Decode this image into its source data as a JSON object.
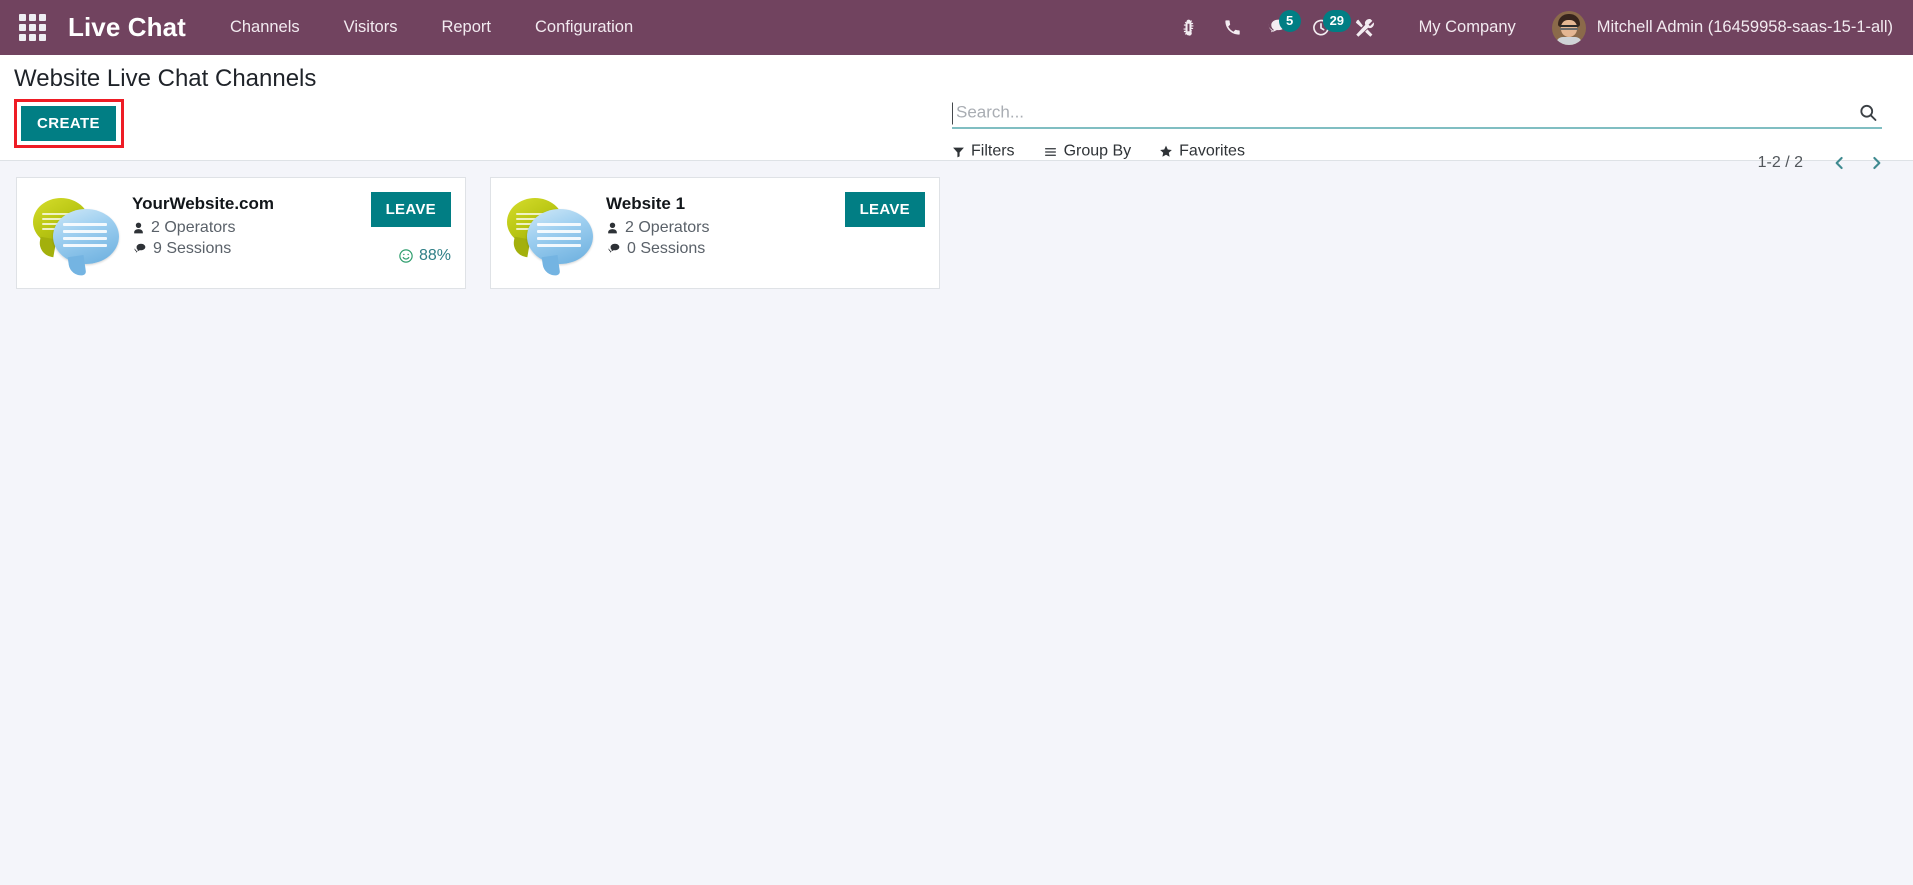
{
  "navbar": {
    "apps_icon": "apps-grid-icon",
    "brand": "Live Chat",
    "menu_items": [
      {
        "label": "Channels",
        "name": "menu-channels"
      },
      {
        "label": "Visitors",
        "name": "menu-visitors"
      },
      {
        "label": "Report",
        "name": "menu-report"
      },
      {
        "label": "Configuration",
        "name": "menu-configuration"
      }
    ],
    "system_icons": [
      {
        "name": "bug-icon",
        "badge": ""
      },
      {
        "name": "phone-icon",
        "badge": ""
      },
      {
        "name": "messages-icon",
        "badge": "5"
      },
      {
        "name": "activity-clock-icon",
        "badge": "29"
      },
      {
        "name": "tools-icon",
        "badge": ""
      }
    ],
    "messages_badge": "5",
    "activities_badge": "29",
    "company": "My Company",
    "user_name": "Mitchell Admin (16459958-saas-15-1-all)",
    "avatar_icon": "user-avatar"
  },
  "control_panel": {
    "title": "Website Live Chat Channels",
    "create_label": "CREATE",
    "highlight_color": "#ee1c25",
    "accent_color": "#017e84",
    "search": {
      "value": "",
      "placeholder": "Search...",
      "icon": "search-icon"
    },
    "filters": [
      {
        "label": "Filters",
        "icon": "funnel-icon",
        "name": "filters-button"
      },
      {
        "label": "Group By",
        "icon": "list-icon",
        "name": "group-by-button"
      },
      {
        "label": "Favorites",
        "icon": "star-icon",
        "name": "favorites-button"
      }
    ],
    "pager": {
      "range": "1-2 / 2",
      "prev_icon": "chevron-left-icon",
      "next_icon": "chevron-right-icon"
    }
  },
  "kanban": {
    "cards": [
      {
        "title": "YourWebsite.com",
        "operators": "2 Operators",
        "sessions": "9 Sessions",
        "button_label": "LEAVE",
        "rating": "88%",
        "has_rating": true,
        "thumb_icon": "chat-bubbles-image"
      },
      {
        "title": "Website 1",
        "operators": "2 Operators",
        "sessions": "0 Sessions",
        "button_label": "LEAVE",
        "rating": "",
        "has_rating": false,
        "thumb_icon": "chat-bubbles-image"
      }
    ]
  }
}
